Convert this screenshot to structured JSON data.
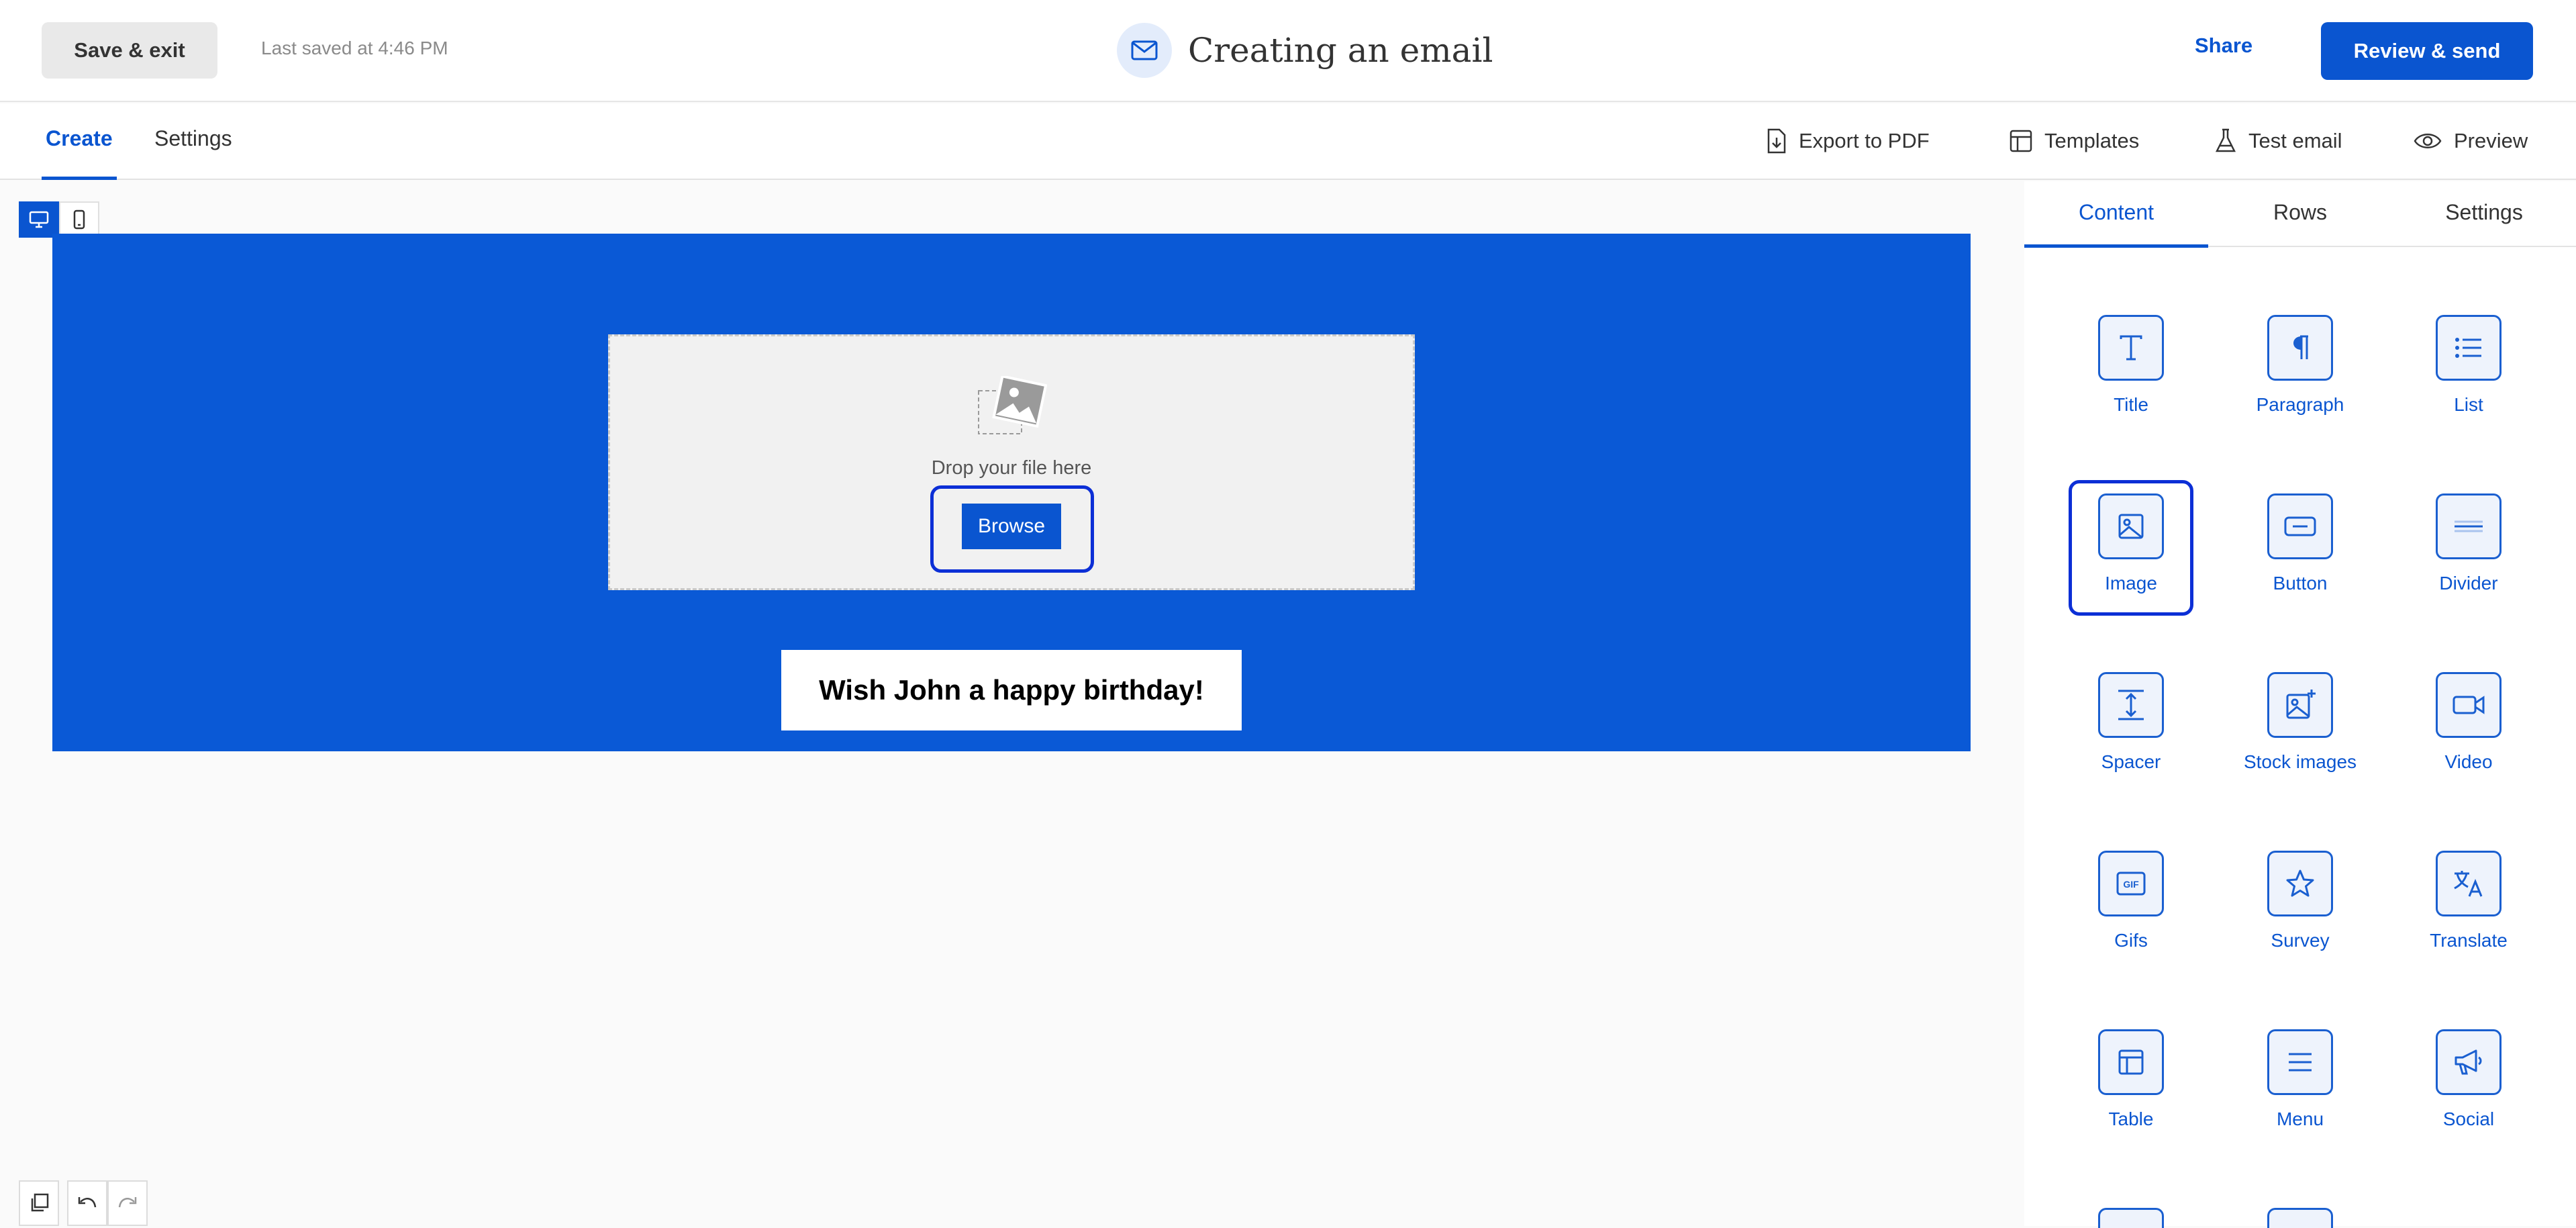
{
  "header": {
    "save_exit_label": "Save & exit",
    "last_saved": "Last saved at 4:46 PM",
    "title": "Creating an email",
    "share_label": "Share",
    "review_label": "Review & send"
  },
  "tabs": {
    "create": "Create",
    "settings": "Settings"
  },
  "toolbar": {
    "export_pdf": "Export to PDF",
    "templates": "Templates",
    "test_email": "Test email",
    "preview": "Preview"
  },
  "canvas": {
    "drop_text": "Drop your file here",
    "browse_label": "Browse",
    "headline": "Wish John a happy birthday!",
    "background_color": "#0a59d6"
  },
  "panel": {
    "tabs": [
      "Content",
      "Rows",
      "Settings"
    ],
    "active_tab": "Content",
    "blocks": [
      {
        "label": "Title",
        "icon": "title-icon"
      },
      {
        "label": "Paragraph",
        "icon": "paragraph-icon"
      },
      {
        "label": "List",
        "icon": "list-icon"
      },
      {
        "label": "Image",
        "icon": "image-icon"
      },
      {
        "label": "Button",
        "icon": "button-icon"
      },
      {
        "label": "Divider",
        "icon": "divider-icon"
      },
      {
        "label": "Spacer",
        "icon": "spacer-icon"
      },
      {
        "label": "Stock images",
        "icon": "stock-images-icon"
      },
      {
        "label": "Video",
        "icon": "video-icon"
      },
      {
        "label": "Gifs",
        "icon": "gif-icon"
      },
      {
        "label": "Survey",
        "icon": "star-icon"
      },
      {
        "label": "Translate",
        "icon": "translate-icon"
      },
      {
        "label": "Table",
        "icon": "table-icon"
      },
      {
        "label": "Menu",
        "icon": "menu-icon"
      },
      {
        "label": "Social",
        "icon": "megaphone-icon"
      }
    ]
  },
  "colors": {
    "accent": "#0a55d0",
    "highlight": "#0c2fd6"
  }
}
